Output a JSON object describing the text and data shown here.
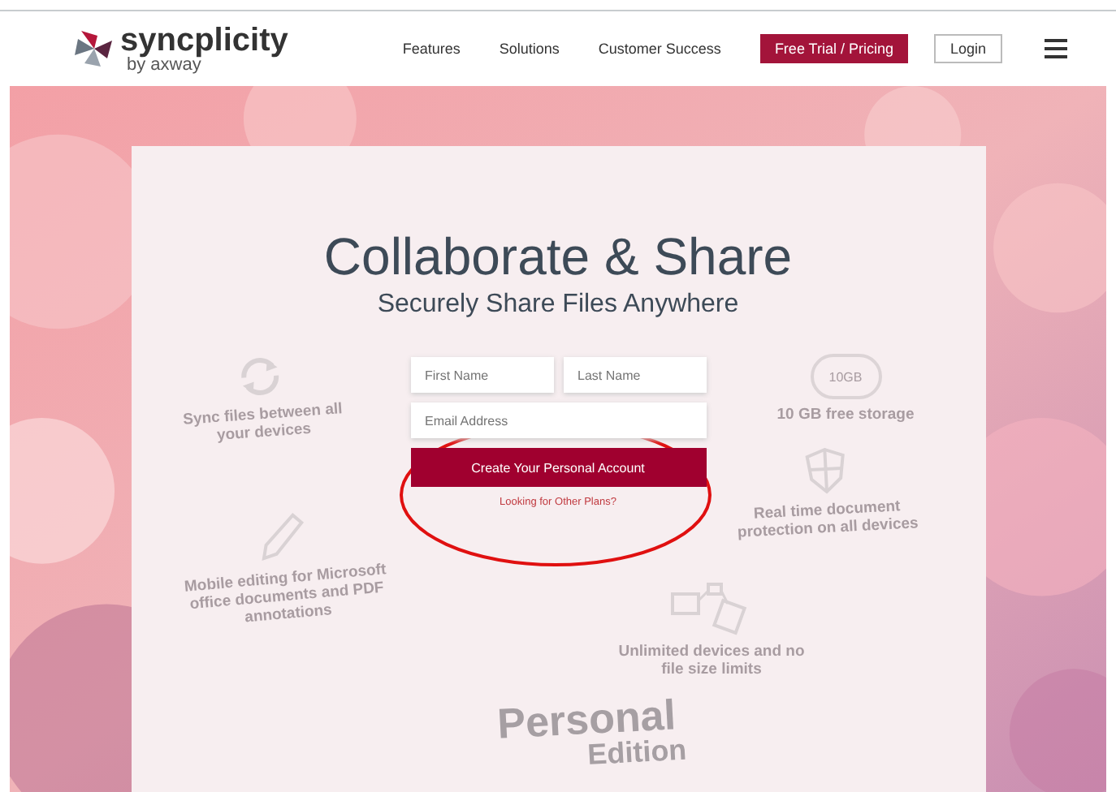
{
  "header": {
    "logo_name": "syncplicity",
    "logo_sub": "by axway",
    "nav": [
      "Features",
      "Solutions",
      "Customer Success"
    ],
    "trial_button": "Free Trial / Pricing",
    "login_button": "Login"
  },
  "hero": {
    "title": "Collaborate & Share",
    "subtitle": "Securely Share Files Anywhere",
    "form": {
      "first_name": {
        "placeholder": "First Name"
      },
      "last_name": {
        "placeholder": "Last Name"
      },
      "email": {
        "placeholder": "Email Address"
      },
      "submit": "Create Your Personal Account",
      "other_plans_link": "Looking for Other Plans?",
      "annotation_circled": true
    },
    "features": [
      {
        "kind": "sync",
        "text": "Sync files between all your devices"
      },
      {
        "kind": "storage",
        "icon_label": "10GB",
        "text": "10 GB free storage"
      },
      {
        "kind": "security",
        "text": "Real time document protection on all devices"
      },
      {
        "kind": "edit",
        "text": "Mobile editing for Microsoft office documents and PDF annotations"
      },
      {
        "kind": "devices",
        "text": "Unlimited devices and no file size limits"
      }
    ],
    "edition": {
      "name": "Personal",
      "sub": "Edition"
    }
  }
}
